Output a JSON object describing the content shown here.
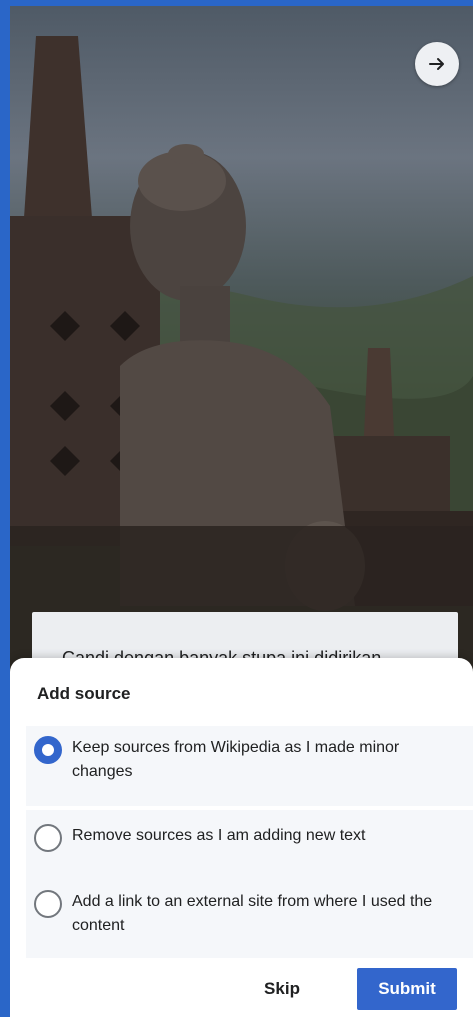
{
  "photo": {
    "alt_icon": "buddha-statue-photo"
  },
  "next_button": {
    "icon": "arrow-right-icon"
  },
  "caption": {
    "text": "Candi dengan banyak stupa ini didirikan"
  },
  "sheet": {
    "title": "Add source",
    "options": [
      {
        "label": "Keep sources from Wikipedia as I made minor changes",
        "selected": true
      },
      {
        "label": "Remove sources as I am adding new text",
        "selected": false
      },
      {
        "label": "Add a link to an external site from where I used the content",
        "selected": false
      }
    ],
    "skip_label": "Skip",
    "submit_label": "Submit"
  },
  "colors": {
    "accent": "#3366cc",
    "page_edge": "#2a66c8"
  }
}
